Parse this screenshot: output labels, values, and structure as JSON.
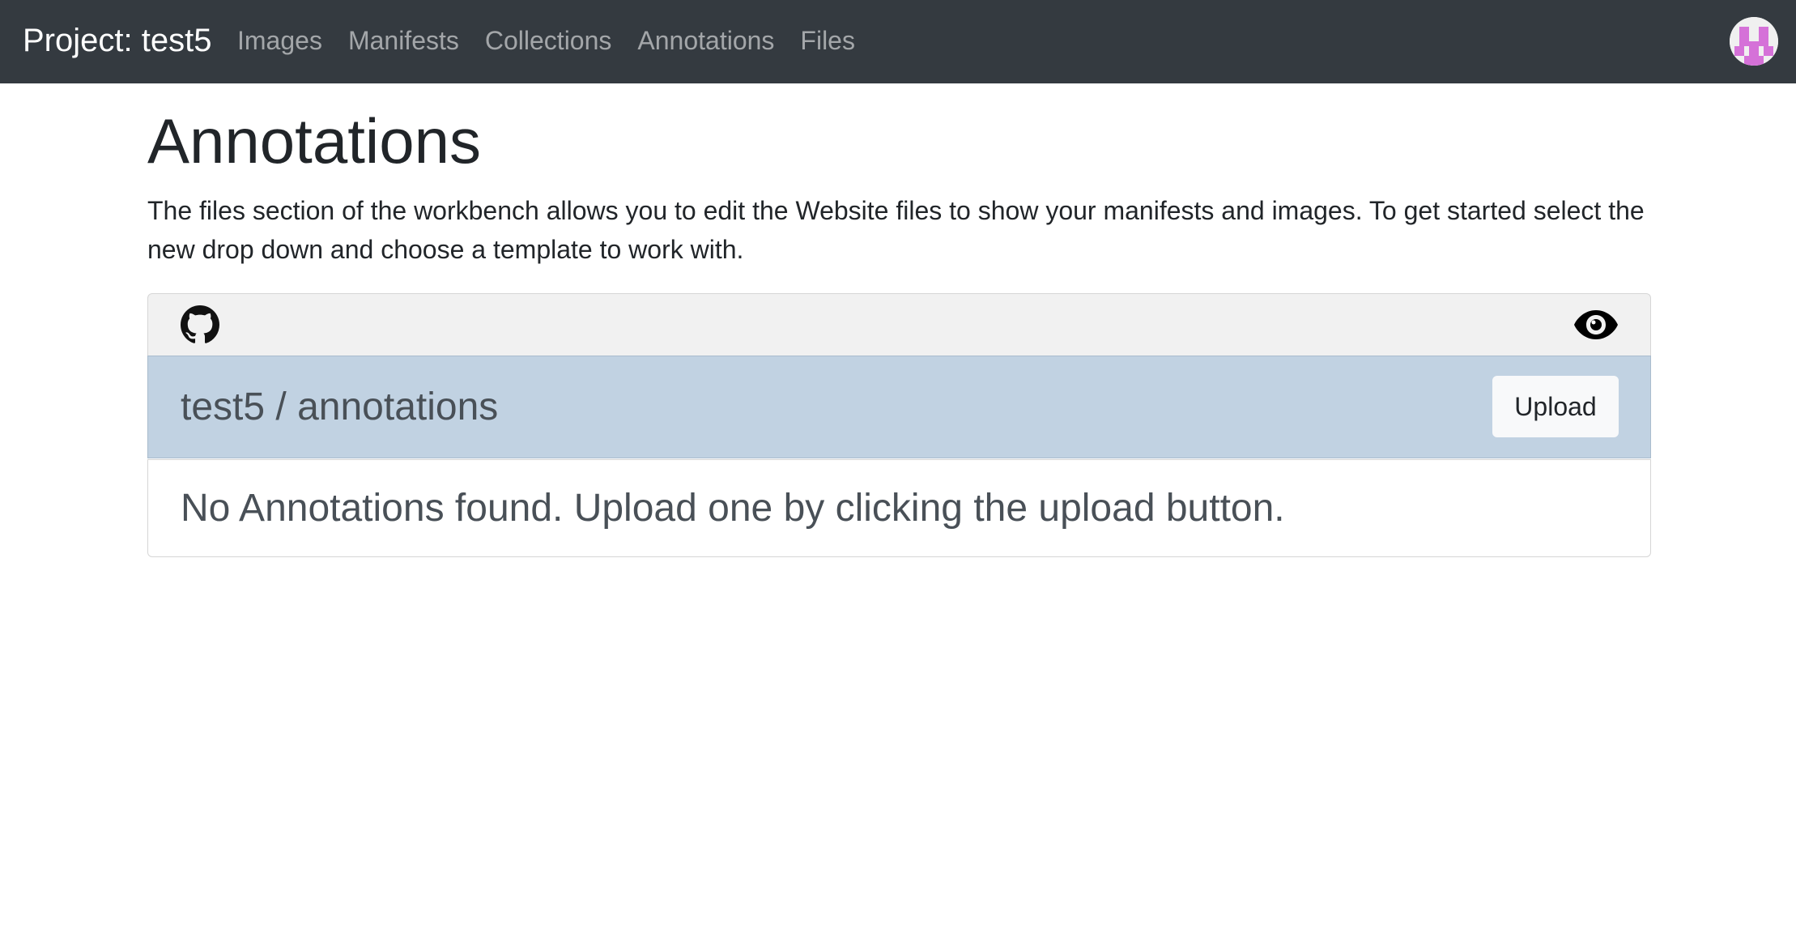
{
  "navbar": {
    "brand": "Project: test5",
    "links": [
      {
        "label": "Images"
      },
      {
        "label": "Manifests"
      },
      {
        "label": "Collections"
      },
      {
        "label": "Annotations"
      },
      {
        "label": "Files"
      }
    ],
    "avatar_icon": "identicon-avatar"
  },
  "page": {
    "title": "Annotations",
    "intro": "The files section of the workbench allows you to edit the Website files to show your manifests and images. To get started select the new drop down and choose a template to work with."
  },
  "panel": {
    "header_icons": [
      "github-icon",
      "eye-icon"
    ],
    "path": "test5 / annotations",
    "upload_label": "Upload",
    "empty_message": "No Annotations found. Upload one by clicking the upload button."
  },
  "colors": {
    "navbar_bg": "#343a40",
    "path_bar_bg": "#c1d2e2",
    "header_bg": "#f1f1f1",
    "avatar_accent": "#d571d8"
  }
}
